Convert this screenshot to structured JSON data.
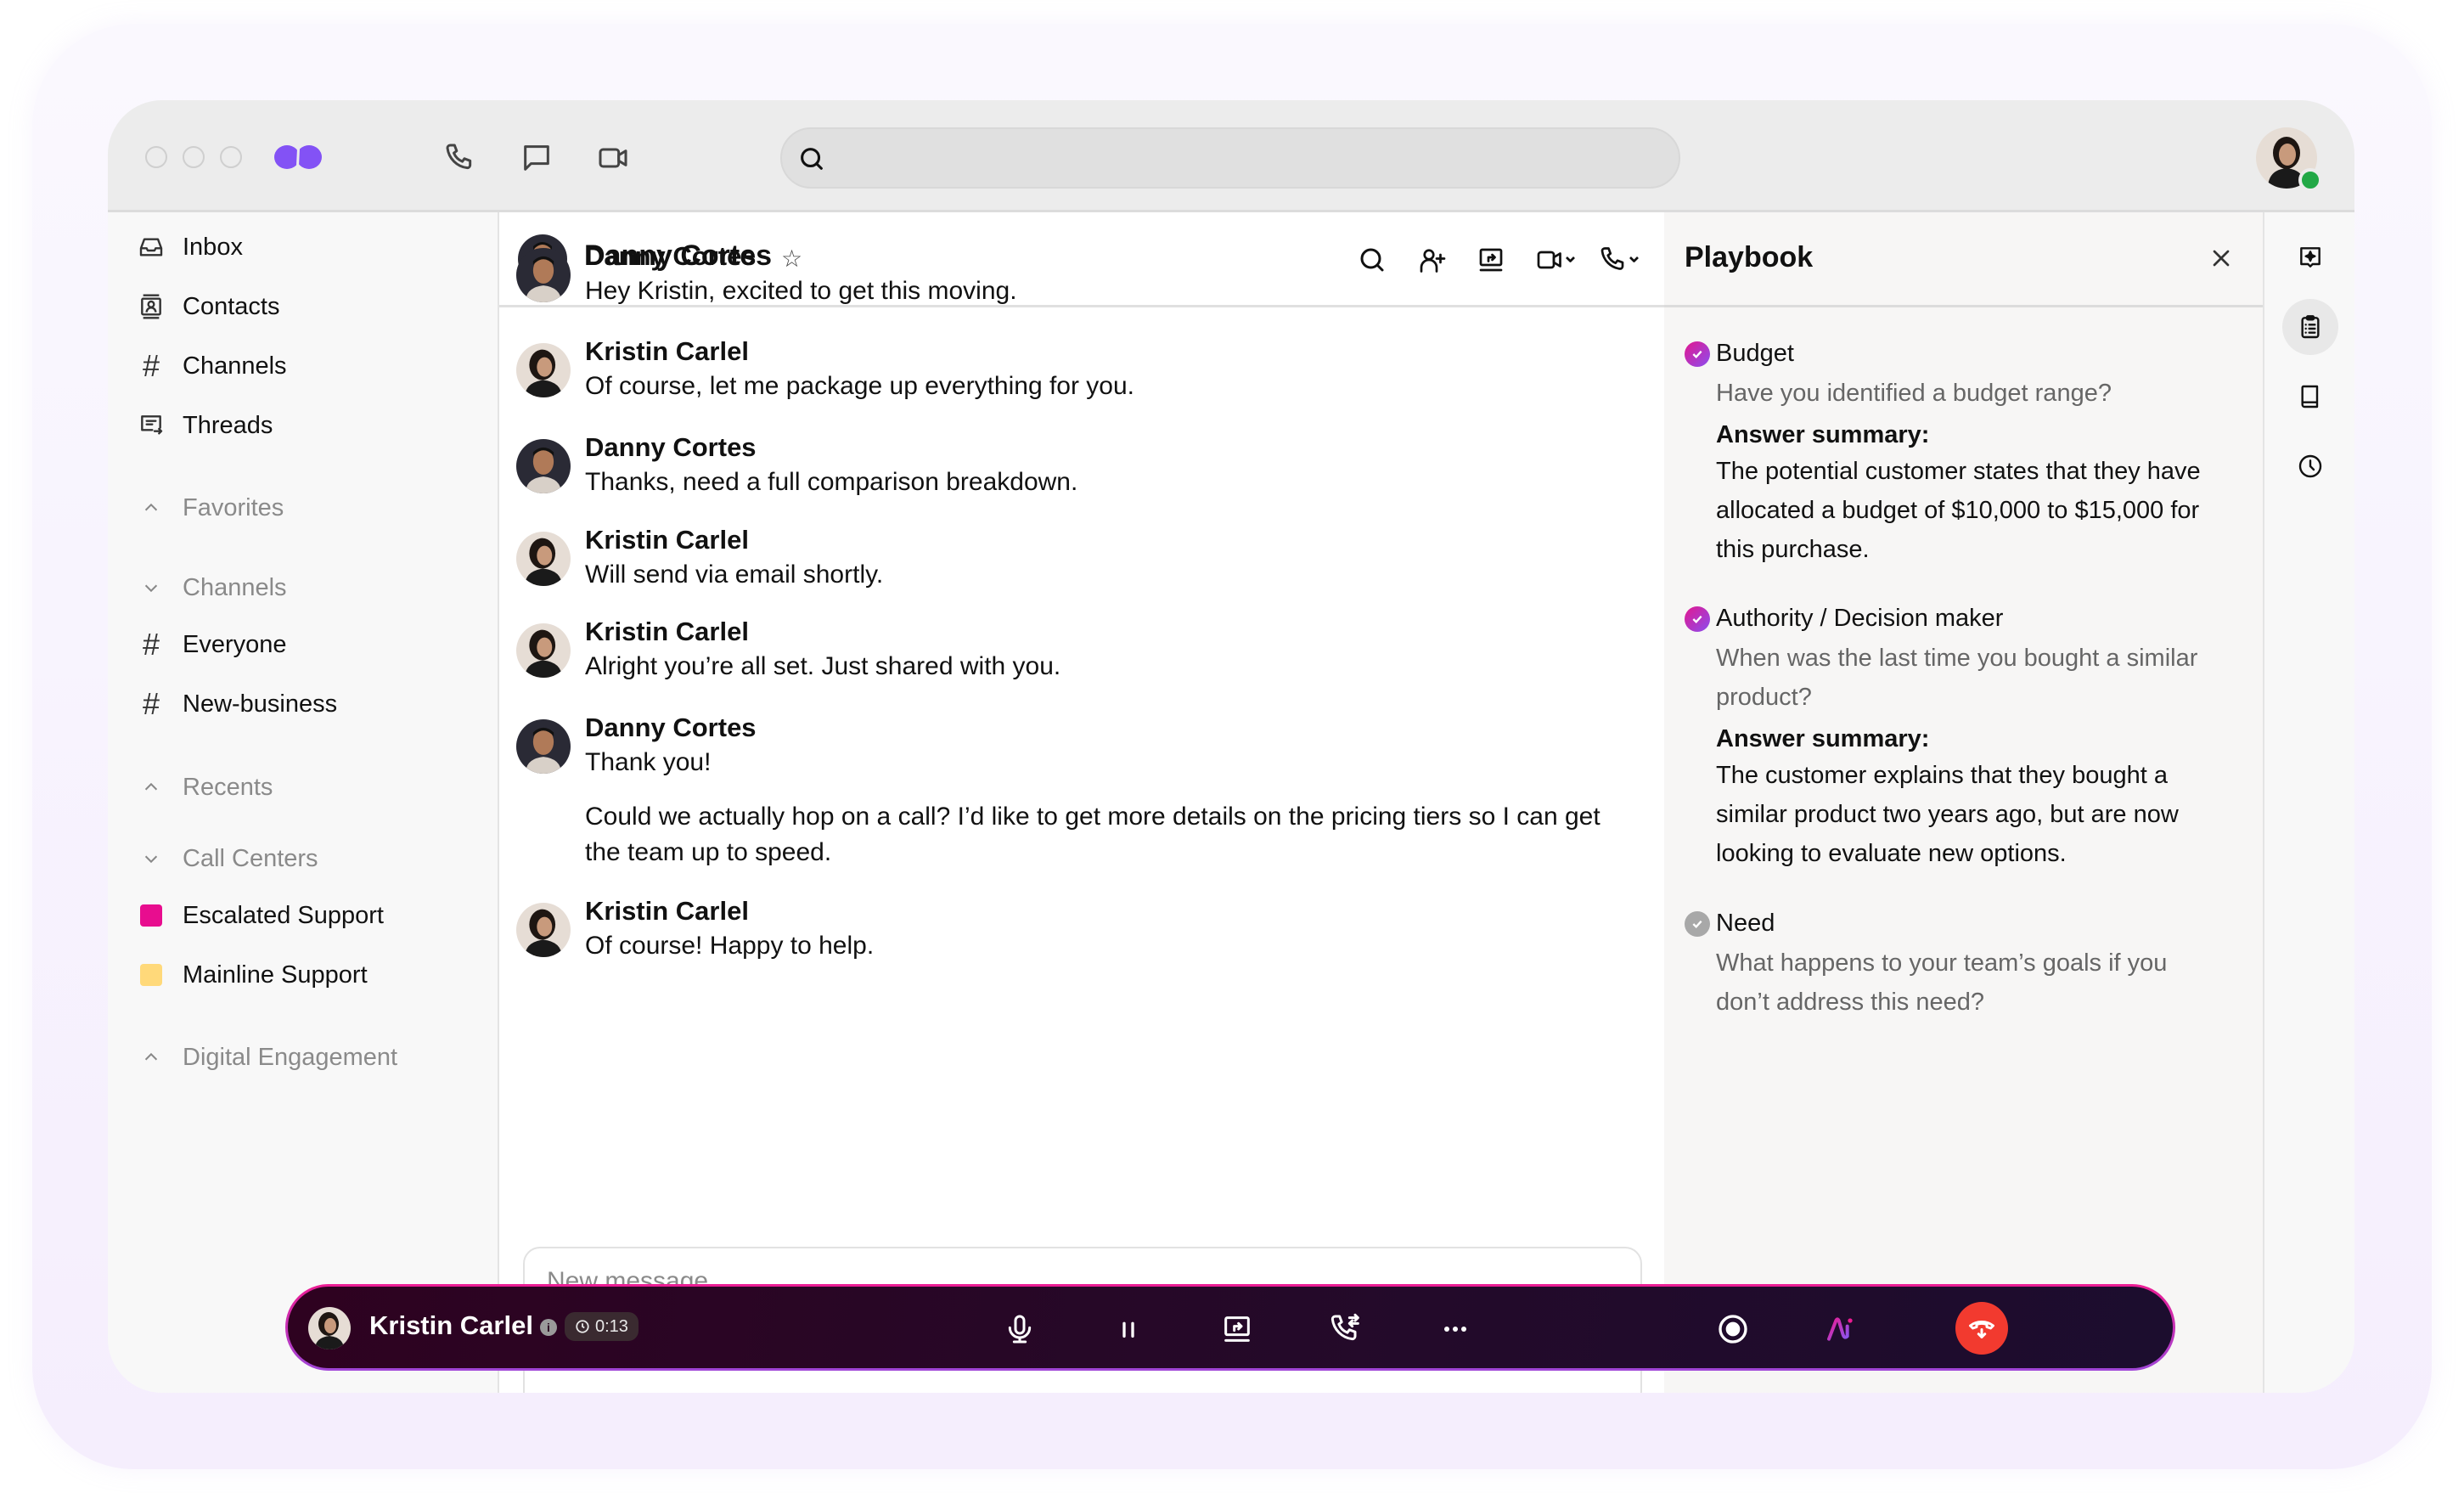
{
  "app": {
    "brand_color": "#8352f5",
    "search_placeholder": ""
  },
  "titlebar": {
    "icons": [
      "phone-icon",
      "message-icon",
      "video-icon"
    ],
    "user_status": "online"
  },
  "sidebar": {
    "primary": [
      {
        "label": "Inbox",
        "icon": "inbox-icon"
      },
      {
        "label": "Contacts",
        "icon": "contacts-icon"
      },
      {
        "label": "Channels",
        "icon": "hash-icon"
      },
      {
        "label": "Threads",
        "icon": "threads-icon"
      }
    ],
    "favorites": {
      "label": "Favorites",
      "expanded": false
    },
    "channels": {
      "label": "Channels",
      "expanded": true,
      "items": [
        {
          "label": "Everyone"
        },
        {
          "label": "New-business"
        }
      ]
    },
    "recents": {
      "label": "Recents",
      "expanded": false
    },
    "call_centers": {
      "label": "Call Centers",
      "expanded": true,
      "items": [
        {
          "label": "Escalated Support",
          "color": "#e80d8f"
        },
        {
          "label": "Mainline Support",
          "color": "#ffd97a"
        }
      ]
    },
    "digital_engagement": {
      "label": "Digital Engagement",
      "expanded": false
    }
  },
  "chat": {
    "contact_name": "Danny Cortes",
    "header_icons": [
      "search-icon",
      "add-user-icon",
      "share-screen-icon",
      "video-dropdown-icon",
      "phone-dropdown-icon"
    ],
    "messages": [
      {
        "sender": "Danny Cortes",
        "text": "Hey Kristin, excited to get this moving."
      },
      {
        "sender": "Kristin Carlel",
        "text": "Of course, let me package up everything for you."
      },
      {
        "sender": "Danny Cortes",
        "text": "Thanks, need a full comparison breakdown."
      },
      {
        "sender": "Kristin Carlel",
        "text": "Will send via email shortly."
      },
      {
        "sender": "Kristin Carlel",
        "text": "Alright you’re all set. Just shared with you."
      },
      {
        "sender": "Danny Cortes",
        "text": "Thank you!",
        "followup": "Could we actually hop on a call? I’d like to get more details on the pricing tiers so I can get the team up to speed."
      },
      {
        "sender": "Kristin Carlel",
        "text": "Of course! Happy to help."
      }
    ],
    "composer": {
      "placeholder": "New message",
      "value": ""
    }
  },
  "playbook": {
    "title": "Playbook",
    "items": [
      {
        "label": "Budget",
        "status": "complete",
        "question": "Have you identified a budget range?",
        "answer_heading": "Answer summary:",
        "answer": "The potential customer states that they have allocated a budget of $10,000 to $15,000 for this purchase."
      },
      {
        "label": "Authority / Decision maker",
        "status": "complete",
        "question": "When was the last time you bought a similar product?",
        "answer_heading": "Answer summary:",
        "answer": "The customer explains that they bought a similar product two years ago, but are now looking to evaluate new options."
      },
      {
        "label": "Need",
        "status": "pending",
        "question": "What happens to your team’s goals if you don’t address this need?"
      }
    ]
  },
  "rail": {
    "items": [
      "ai-assist-icon",
      "playbook-icon",
      "knowledge-book-icon",
      "history-clock-icon"
    ],
    "active": 1
  },
  "call": {
    "caller": "Kristin Carlel",
    "info_glyph": "i",
    "duration": "0:13",
    "controls": [
      "mute-icon",
      "hold-icon",
      "share-screen-icon",
      "transfer-icon",
      "more-icon",
      "record-icon",
      "ai-icon",
      "hangup-icon"
    ],
    "hangup_color": "#f23a2f"
  }
}
